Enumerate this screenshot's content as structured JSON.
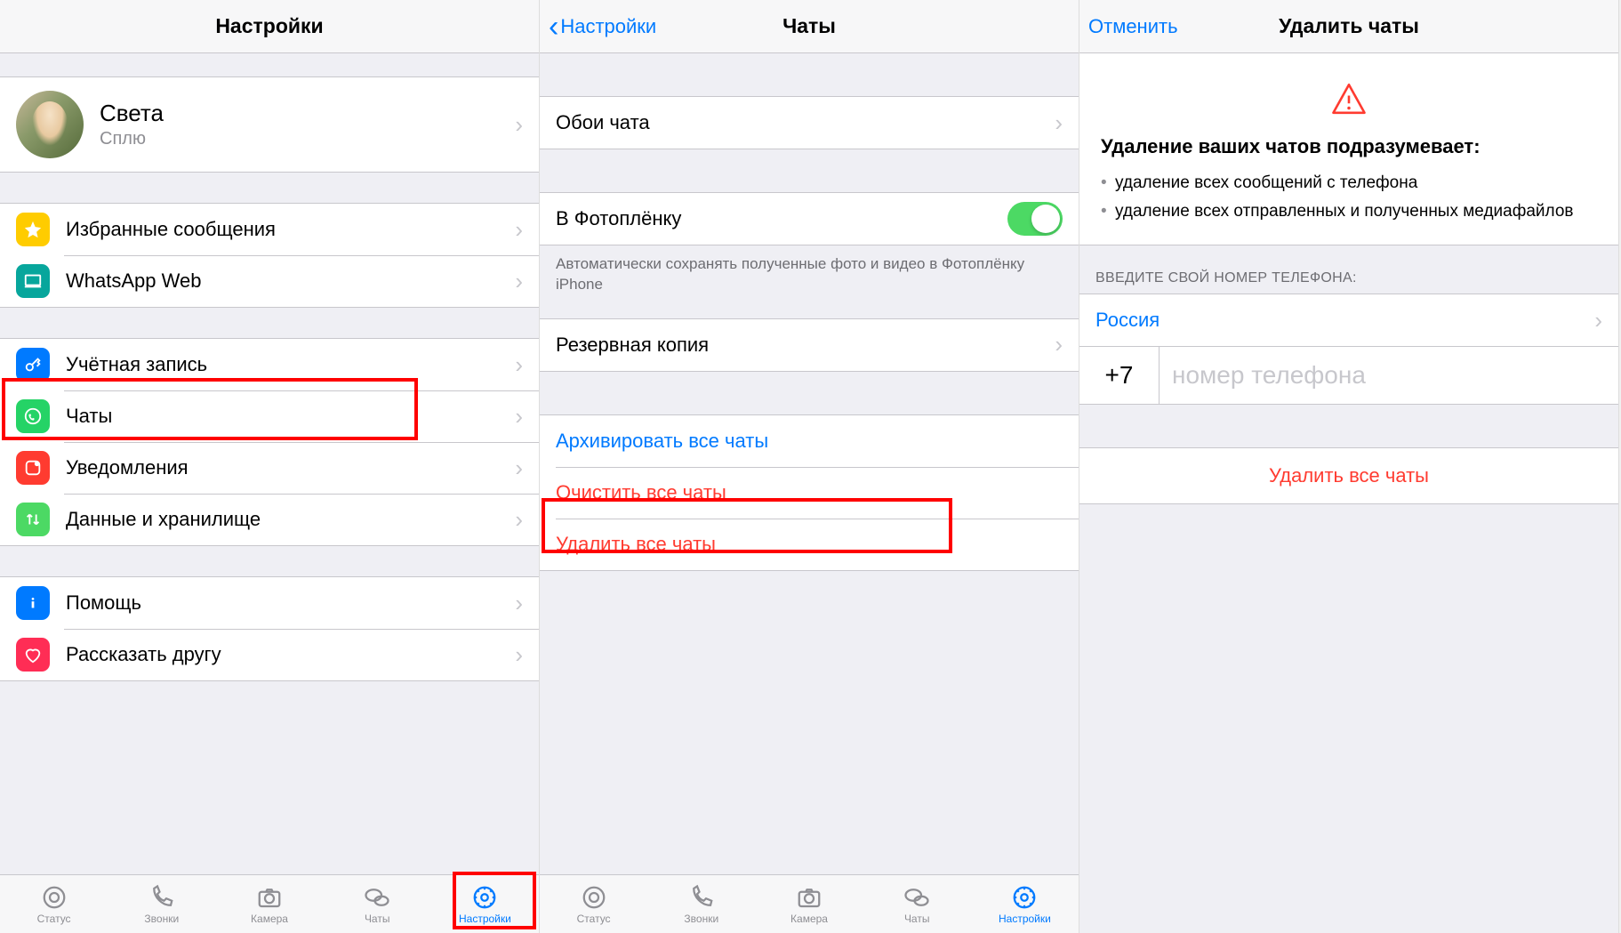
{
  "screen1": {
    "title": "Настройки",
    "profile": {
      "name": "Света",
      "status": "Сплю"
    },
    "group1": [
      {
        "icon": "star",
        "color": "#ffcc00",
        "label": "Избранные сообщения"
      },
      {
        "icon": "laptop",
        "color": "#07a69c",
        "label": "WhatsApp Web"
      }
    ],
    "group2": [
      {
        "icon": "key",
        "color": "#007aff",
        "label": "Учётная запись"
      },
      {
        "icon": "whatsapp",
        "color": "#25d366",
        "label": "Чаты"
      },
      {
        "icon": "bell",
        "color": "#ff3b30",
        "label": "Уведомления"
      },
      {
        "icon": "updown",
        "color": "#4cd964",
        "label": "Данные и хранилище"
      }
    ],
    "group3": [
      {
        "icon": "info",
        "color": "#007aff",
        "label": "Помощь"
      },
      {
        "icon": "heart",
        "color": "#ff2d55",
        "label": "Рассказать другу"
      }
    ],
    "tabs": [
      {
        "label": "Статус"
      },
      {
        "label": "Звонки"
      },
      {
        "label": "Камера"
      },
      {
        "label": "Чаты"
      },
      {
        "label": "Настройки"
      }
    ]
  },
  "screen2": {
    "back": "Настройки",
    "title": "Чаты",
    "wallpaper": "Обои чата",
    "camera_roll": "В Фотоплёнку",
    "camera_roll_note": "Автоматически сохранять полученные фото и видео в Фотоплёнку iPhone",
    "backup": "Резервная копия",
    "archive": "Архивировать все чаты",
    "clear": "Очистить все чаты",
    "delete": "Удалить все чаты",
    "tabs": [
      {
        "label": "Статус"
      },
      {
        "label": "Звонки"
      },
      {
        "label": "Камера"
      },
      {
        "label": "Чаты"
      },
      {
        "label": "Настройки"
      }
    ]
  },
  "screen3": {
    "cancel": "Отменить",
    "title": "Удалить чаты",
    "warn_title": "Удаление ваших чатов подразумевает:",
    "warn_items": [
      "удаление всех сообщений с телефона",
      "удаление всех отправленных и полученных медиафайлов"
    ],
    "phone_header": "ВВЕДИТЕ СВОЙ НОМЕР ТЕЛЕФОНА:",
    "country": "Россия",
    "dial_code": "+7",
    "phone_placeholder": "номер телефона",
    "delete_button": "Удалить все чаты"
  }
}
